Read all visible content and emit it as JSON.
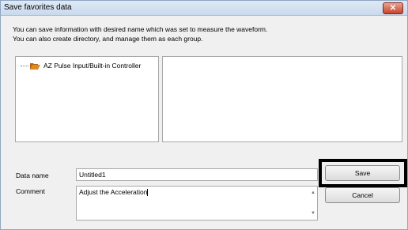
{
  "window": {
    "title": "Save favorites data",
    "close_glyph": "✕"
  },
  "description": {
    "line1": "You can save information with desired name which was set to measure the waveform.",
    "line2": "You can also create  directory, and manage them as each group."
  },
  "tree": {
    "items": [
      {
        "label": "AZ Pulse Input/Built-in Controller",
        "icon": "folder-icon"
      }
    ]
  },
  "form": {
    "data_name_label": "Data name",
    "data_name_value": "Untitled1",
    "comment_label": "Comment",
    "comment_value": "Adjust the Acceleration"
  },
  "buttons": {
    "save_label": "Save",
    "cancel_label": "Cancel"
  },
  "colors": {
    "folder": "#e08a1e",
    "close_button": "#c7432b",
    "highlight": "#000000"
  }
}
